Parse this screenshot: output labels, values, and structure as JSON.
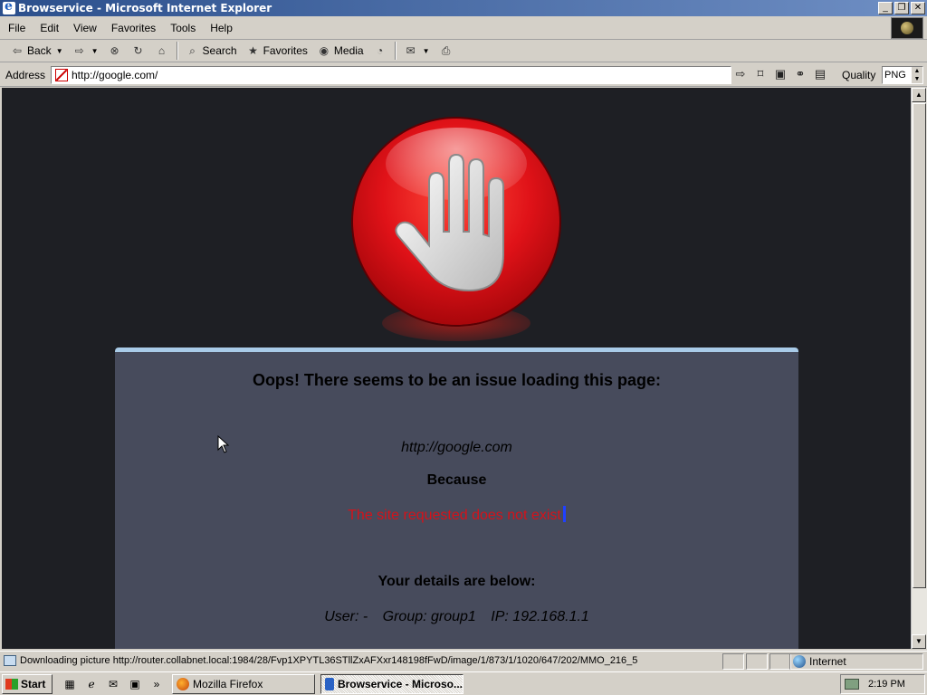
{
  "window": {
    "title": "Browservice - Microsoft Internet Explorer",
    "controls": [
      "_",
      "❐",
      "✕"
    ]
  },
  "menu": [
    "File",
    "Edit",
    "View",
    "Favorites",
    "Tools",
    "Help"
  ],
  "toolbar": {
    "back": "Back",
    "search": "Search",
    "favorites": "Favorites",
    "media": "Media"
  },
  "address": {
    "label": "Address",
    "url": "http://google.com/",
    "quality_label": "Quality",
    "quality_value": "PNG"
  },
  "page": {
    "heading": "Oops! There seems to be an issue loading this page:",
    "url": "http://google.com",
    "because": "Because",
    "reason": "The site requested does not exist",
    "details_heading": "Your details are below:",
    "user": "User: -",
    "group": "Group: group1",
    "ip": "IP: 192.168.1.1"
  },
  "status": {
    "text": "Downloading picture http://router.collabnet.local:1984/28/Fvp1XPYTL36STllZxAFXxr148198fFwD/image/1/873/1/1020/647/202/MMO_216_5",
    "zone": "Internet"
  },
  "taskbar": {
    "start": "Start",
    "tasks": [
      "Mozilla Firefox",
      "Browservice - Microso..."
    ],
    "clock": "2:19 PM"
  },
  "colors": {
    "page_bg": "#1e1f24",
    "panel_bg": "#474b5c",
    "panel_border": "#a9cbe8",
    "reason_red": "#d5121a",
    "stop_red": "#e01218"
  }
}
